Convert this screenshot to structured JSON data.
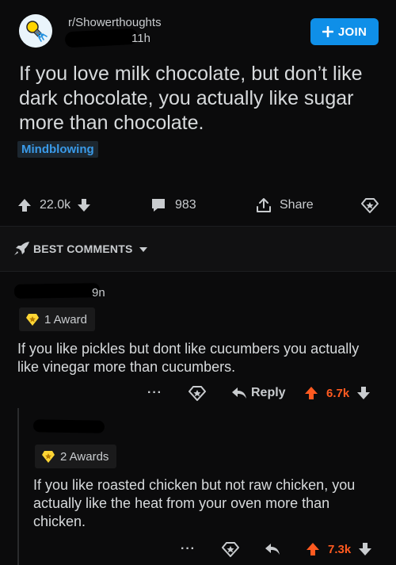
{
  "post": {
    "subreddit": "r/Showerthoughts",
    "time": "11h",
    "join_label": "JOIN",
    "title": "If you love milk chocolate, but don’t like dark chocolate, you actually like sugar more than chocolate.",
    "flair": "Mindblowing",
    "score": "22.0k",
    "comments": "983",
    "share_label": "Share"
  },
  "sort": {
    "label": "BEST COMMENTS"
  },
  "comments": [
    {
      "meta_fragment": "9n",
      "awards": "1 Award",
      "text": "If you like pickles but dont like cucumbers you actually like vinegar more than cucumbers.",
      "reply_label": "Reply",
      "score": "6.7k"
    },
    {
      "awards": "2 Awards",
      "text": "If you like roasted chicken but not raw chicken, you actually like the heat from your oven more than chicken.",
      "score": "7.3k"
    }
  ],
  "icons": {
    "more": "more-options-icon",
    "award": "award-icon",
    "reply": "reply-arrow-icon",
    "upvote": "upvote-arrow-icon",
    "downvote": "downvote-arrow-icon"
  },
  "colors": {
    "background": "#0b0b0c",
    "join": "#0f8fe8",
    "flair_text": "#3a9ae8",
    "upvoted": "#ff5a20"
  }
}
